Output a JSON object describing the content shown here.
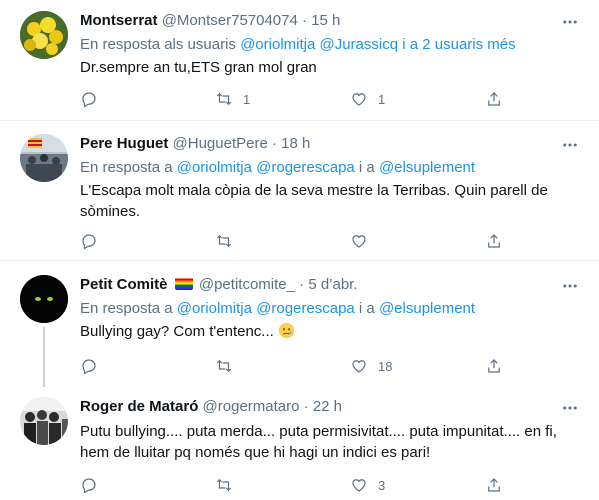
{
  "tweets": [
    {
      "name": "Montserrat",
      "handle": "@Montser75704074",
      "dot": "·",
      "time": "15 h",
      "reply_prefix": "En resposta als usuaris ",
      "reply_mentions": "@oriolmitja @Jurassicq",
      "reply_suffix": " i a 2 usuaris més",
      "text": "Dr.sempre an tu,ETS gran mol gran",
      "reply_count": "",
      "retweet_count": "1",
      "like_count": "1",
      "icons": {
        "reply": "comment-icon",
        "retweet": "retweet-icon",
        "like": "heart-icon",
        "share": "share-icon",
        "more": "more-icon"
      }
    },
    {
      "name": "Pere Huguet",
      "handle": "@HuguetPere",
      "dot": "·",
      "time": "18 h",
      "reply_prefix": "En resposta a ",
      "reply_mentions_1": "@oriolmitja @rogerescapa",
      "reply_mid": " i a ",
      "reply_mentions_2": "@elsuplement",
      "text": "L'Escapa molt mala còpia de la seva mestre la Terribas. Quin parell de sòmines.",
      "reply_count": "",
      "retweet_count": "",
      "like_count": ""
    },
    {
      "name": "Petit Comitè",
      "handle": "@petitcomite_",
      "dot": "·",
      "time": "5 d’abr.",
      "reply_prefix": "En resposta a ",
      "reply_mentions_1": "@oriolmitja @rogerescapa",
      "reply_mid": " i a ",
      "reply_mentions_2": "@elsuplement",
      "text": "Bullying gay? Com t'entenc...",
      "emoji": "crying-face-icon",
      "reply_count": "",
      "retweet_count": "",
      "like_count": "18"
    },
    {
      "name": "Roger de Mataró",
      "handle": "@rogermataro",
      "dot": "·",
      "time": "22 h",
      "text": "Putu bullying.... puta merda... puta permisivitat.... puta impunitat.... en fi, hem de lluitar pq només que hi hagi un indici es pari!",
      "reply_count": "",
      "retweet_count": "",
      "like_count": "3"
    }
  ],
  "colors": {
    "text": "#0f1419",
    "secondary": "#5b7083",
    "link": "#1b95e0",
    "border": "#e6ecf0"
  }
}
